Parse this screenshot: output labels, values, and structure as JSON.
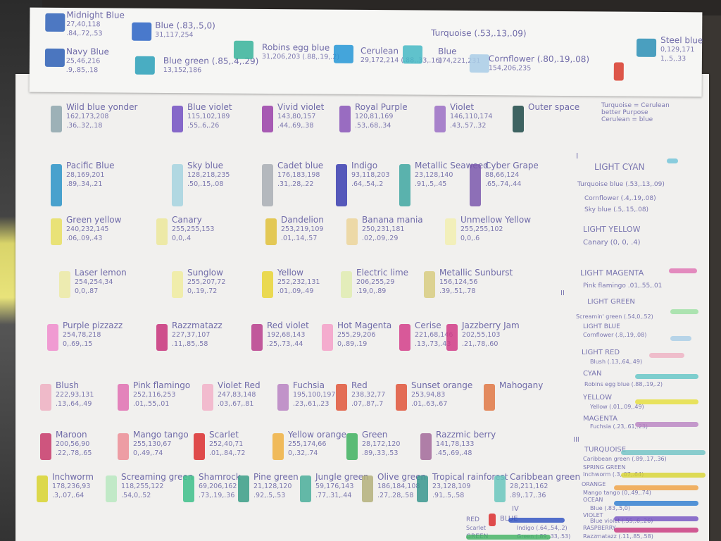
{
  "strip": [
    {
      "name": "Midnight Blue",
      "vals": "27,40,118",
      "cmy": ".84,.72,.53"
    },
    {
      "name": "Navy Blue",
      "vals": "25,46,216",
      "cmy": ".9,.85,.18"
    },
    {
      "name": "Blue (.83,.5,0)",
      "vals": "31,117,254"
    },
    {
      "name": "Blue green (.85,.4,.29)",
      "vals": "13,152,186"
    },
    {
      "name": "Robins egg blue",
      "vals": "31,206,203 (.88,.19,.2)"
    },
    {
      "name": "Cerulean",
      "vals": "29,172,214 (.88,.33,.16)"
    },
    {
      "name": "Turquoise (.53,.13,.09)",
      "vals": ""
    },
    {
      "name": "Blue",
      "vals": "174,221,231"
    },
    {
      "name": "Cornflower (.80,.19,.08)",
      "vals": "154,206,235"
    },
    {
      "name": "Steel blue",
      "vals": "0,129,171",
      "cmy": "1,.5,.33"
    }
  ],
  "grid": [
    {
      "name": "Wild blue yonder",
      "vals": "162,173,208",
      "cmy": ".36,.32,.18",
      "color": "#8ea6ad"
    },
    {
      "name": "Blue violet",
      "vals": "115,102,189",
      "cmy": ".55,.6,.26",
      "color": "#7350c2"
    },
    {
      "name": "Vivid violet",
      "vals": "143,80,157",
      "cmy": ".44,.69,.38",
      "color": "#9a3fa8"
    },
    {
      "name": "Royal Purple",
      "vals": "120,81,169",
      "cmy": ".53,.68,.34",
      "color": "#8a55b8"
    },
    {
      "name": "Violet",
      "vals": "146,110,174",
      "cmy": ".43,.57,.32",
      "color": "#9b6ec4"
    },
    {
      "name": "Outer space",
      "vals": "",
      "cmy": "",
      "color": "#1f4a48"
    },
    {
      "name": "Pacific Blue",
      "vals": "28,169,201",
      "cmy": ".89,.34,.21",
      "color": "#2a93c7"
    },
    {
      "name": "Sky blue",
      "vals": "128,218,235",
      "cmy": ".50,.15,.08",
      "color": "#a6d4df"
    },
    {
      "name": "Cadet blue",
      "vals": "176,183,198",
      "cmy": ".31,.28,.22",
      "color": "#a9aeb4"
    },
    {
      "name": "Indigo",
      "vals": "93,118,203",
      "cmy": ".64,.54,.2",
      "color": "#3a3db0"
    },
    {
      "name": "Metallic Seaweed",
      "vals": "23,128,140",
      "cmy": ".91,.5,.45",
      "color": "#3fa7a1"
    },
    {
      "name": "Cyber Grape",
      "vals": "88,66,124",
      "cmy": ".65,.74,.44",
      "color": "#7b58ad"
    },
    {
      "name": "Green yellow",
      "vals": "240,232,145",
      "cmy": ".06,.09,.43",
      "color": "#e8df62"
    },
    {
      "name": "Canary",
      "vals": "255,255,153",
      "cmy": "0,0,.4",
      "color": "#ece79a"
    },
    {
      "name": "Dandelion",
      "vals": "253,219,109",
      "cmy": ".01,.14,.57",
      "color": "#e0c13a"
    },
    {
      "name": "Banana mania",
      "vals": "250,231,181",
      "cmy": ".02,.09,.29",
      "color": "#ecd59a"
    },
    {
      "name": "Unmellow Yellow",
      "vals": "255,255,102",
      "cmy": "0,0,.6",
      "color": "#f2eeb0"
    },
    {
      "name": "Laser lemon",
      "vals": "254,254,34",
      "cmy": "0,0,.87",
      "color": "#eceaa4"
    },
    {
      "name": "Sunglow",
      "vals": "255,207,72",
      "cmy": "0,.19,.72",
      "color": "#f0ec9f"
    },
    {
      "name": "Yellow",
      "vals": "252,232,131",
      "cmy": ".01,.09,.49",
      "color": "#e9d535"
    },
    {
      "name": "Electric lime",
      "vals": "206,255,29",
      "cmy": ".19,0,.89",
      "color": "#e0ecb0"
    },
    {
      "name": "Metallic Sunburst",
      "vals": "156,124,56",
      "cmy": ".39,.51,.78",
      "color": "#d8cd80"
    },
    {
      "name": "Purple pizzazz",
      "vals": "254,78,218",
      "cmy": "0,.69,.15",
      "color": "#f08ccc"
    },
    {
      "name": "Razzmatazz",
      "vals": "227,37,107",
      "cmy": ".11,.85,.58",
      "color": "#c8327a"
    },
    {
      "name": "Red violet",
      "vals": "192,68,143",
      "cmy": ".25,.73,.44",
      "color": "#b93d8c"
    },
    {
      "name": "Hot Magenta",
      "vals": "255,29,206",
      "cmy": "0,.89,.19",
      "color": "#f4a0c8"
    },
    {
      "name": "Cerise",
      "vals": "221,68,146",
      "cmy": ".13,.73,.43",
      "color": "#d43e8a"
    },
    {
      "name": "Jazzberry Jam",
      "vals": "202,55,103",
      "cmy": ".21,.78,.60",
      "color": "#d13b86"
    },
    {
      "name": "Blush",
      "vals": "222,93,131",
      "cmy": ".13,.64,.49",
      "color": "#efb0c2"
    },
    {
      "name": "Pink flamingo",
      "vals": "252,116,253",
      "cmy": ".01,.55,.01",
      "color": "#e070b2"
    },
    {
      "name": "Violet Red",
      "vals": "247,83,148",
      "cmy": ".03,.67,.81",
      "color": "#f2b2c8"
    },
    {
      "name": "Fuchsia",
      "vals": "195,100,197",
      "cmy": ".23,.61,.23",
      "color": "#b982c2"
    },
    {
      "name": "Red",
      "vals": "238,32,77",
      "cmy": ".07,.87,.7",
      "color": "#e0563a"
    },
    {
      "name": "Sunset orange",
      "vals": "253,94,83",
      "cmy": ".01,.63,.67",
      "color": "#e0553a"
    },
    {
      "name": "Mahogany",
      "vals": "",
      "cmy": "",
      "color": "#e07844"
    },
    {
      "name": "Maroon",
      "vals": "200,56,90",
      "cmy": ".22,.78,.65",
      "color": "#c83a6a"
    },
    {
      "name": "Mango tango",
      "vals": "255,130,67",
      "cmy": "0,.49,.74",
      "color": "#ec8e96"
    },
    {
      "name": "Scarlet",
      "vals": "252,40,71",
      "cmy": ".01,.84,.72",
      "color": "#dc2e2e"
    },
    {
      "name": "Yellow orange",
      "vals": "255,174,66",
      "cmy": "0,.32,.74",
      "color": "#f0b040"
    },
    {
      "name": "Green",
      "vals": "28,172,120",
      "cmy": ".89,.33,.53",
      "color": "#3fb25f"
    },
    {
      "name": "Razzmic berry",
      "vals": "141,78,133",
      "cmy": ".45,.69,.48",
      "color": "#a36a9a"
    },
    {
      "name": "Inchworm",
      "vals": "178,236,93",
      "cmy": ".3,.07,.64",
      "color": "#d8d42e"
    },
    {
      "name": "Screaming green",
      "vals": "118,255,122",
      "cmy": ".54,0,.52",
      "color": "#b8e8c0"
    },
    {
      "name": "Shamrock",
      "vals": "69,206,162",
      "cmy": ".73,.19,.36",
      "color": "#3ec08a"
    },
    {
      "name": "Pine green",
      "vals": "21,128,120",
      "cmy": ".92,.5,.53",
      "color": "#3a9e86"
    },
    {
      "name": "Jungle green",
      "vals": "59,176,143",
      "cmy": ".77,.31,.44",
      "color": "#4aae9a"
    },
    {
      "name": "Olive green",
      "vals": "186,184,108",
      "cmy": ".27,.28,.58",
      "color": "#b4b07a"
    },
    {
      "name": "Tropical rainforest",
      "vals": "23,128,109",
      "cmy": ".91,.5,.58",
      "color": "#3a968e"
    },
    {
      "name": "Caribbean green",
      "vals": "28,211,162",
      "cmy": ".89,.17,.36",
      "color": "#6ac7bd"
    }
  ],
  "right": {
    "note": "Turquoise = Cerulean\nbetter Purpose\nCerulean = blue",
    "sec1": "I",
    "light_cyan": "LIGHT CYAN",
    "turq": "Turquoise blue (.53,.13,.09)",
    "corn": "Cornflower (.4,.19,.08)",
    "sky": "Sky blue (.5,.15,.08)",
    "light_yellow": "LIGHT YELLOW",
    "canary": "Canary (0, 0, .4)",
    "light_magenta": "LIGHT MAGENTA",
    "sec2": "II",
    "pink": "Pink flamingo .01,.55,.01",
    "light_green": "LIGHT GREEN",
    "screamin": "Screamin' green (.54,0,.52)",
    "light_blue": "LIGHT BLUE",
    "cornflower2": "Cornflower (.8,.19,.08)",
    "light_red": "LIGHT RED",
    "blush": "Blush (.13,.64,.49)",
    "cyan": "CYAN",
    "robins": "Robins egg blue (.88,.19,.2)",
    "yellow": "YELLOW",
    "yellow_v": "Yellow (.01,.09,.49)",
    "magenta": "MAGENTA",
    "fuchsia": "Fuchsia (.23,.61,.23)",
    "sec3": "III",
    "turq2": "TURQUOISE",
    "carib": "Caribbean green (.89,.17,.36)",
    "spring": "SPRING GREEN",
    "inchworm": "Inchworm (.3,.07,.64)",
    "orange": "ORANGE",
    "mango": "Mango tango (0,.49,.74)",
    "ocean": "OCEAN",
    "blue3": "Blue (.83,.5,0)",
    "violet3": "VIOLET",
    "bviolet": "Blue violet (.55,.6,.26)",
    "rasp": "RASPBERRY",
    "razz": "Razzmatazz (.11,.85,.58)",
    "sec4": "IV",
    "red4": "RED",
    "scarlet": "Scarlet",
    "blue4": "BLUE",
    "indigo4": "Indigo (.64,.54,.2)",
    "green4": "GREEN",
    "green4v": "Green (.89,.33,.53)"
  }
}
